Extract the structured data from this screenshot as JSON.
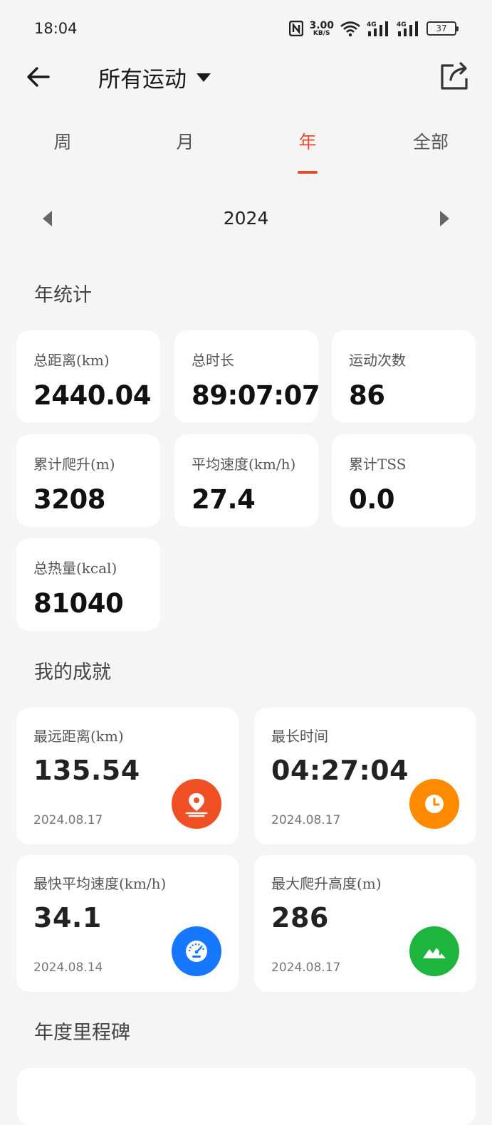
{
  "status": {
    "time": "18:04",
    "net_speed": "3.00",
    "net_unit": "KB/S",
    "battery": "37"
  },
  "header": {
    "title": "所有运动"
  },
  "tabs": [
    "周",
    "月",
    "年",
    "全部"
  ],
  "active_tab": "年",
  "year": "2024",
  "sections": {
    "year_stats": "年统计",
    "achievements": "我的成就",
    "milestones": "年度里程碑"
  },
  "stats": [
    {
      "label": "总距离(km)",
      "value": "2440.04"
    },
    {
      "label": "总时长",
      "value": "89:07:07"
    },
    {
      "label": "运动次数",
      "value": "86"
    },
    {
      "label": "累计爬升(m)",
      "value": "3208"
    },
    {
      "label": "平均速度(km/h)",
      "value": "27.4"
    },
    {
      "label": "累计TSS",
      "value": "0.0"
    },
    {
      "label": "总热量(kcal)",
      "value": "81040"
    }
  ],
  "achievements": [
    {
      "label": "最远距离(km)",
      "value": "135.54",
      "date": "2024.08.17",
      "icon": "location-pin-icon",
      "color": "#f04e23"
    },
    {
      "label": "最长时间",
      "value": "04:27:04",
      "date": "2024.08.17",
      "icon": "clock-icon",
      "color": "#ff8a00"
    },
    {
      "label": "最快平均速度(km/h)",
      "value": "34.1",
      "date": "2024.08.14",
      "icon": "speedometer-icon",
      "color": "#1677ff"
    },
    {
      "label": "最大爬升高度(m)",
      "value": "286",
      "date": "2024.08.17",
      "icon": "mountain-icon",
      "color": "#1db53e"
    }
  ],
  "colors": {
    "accent": "#e84a2f",
    "background": "#f5f5f5",
    "card": "#ffffff"
  }
}
